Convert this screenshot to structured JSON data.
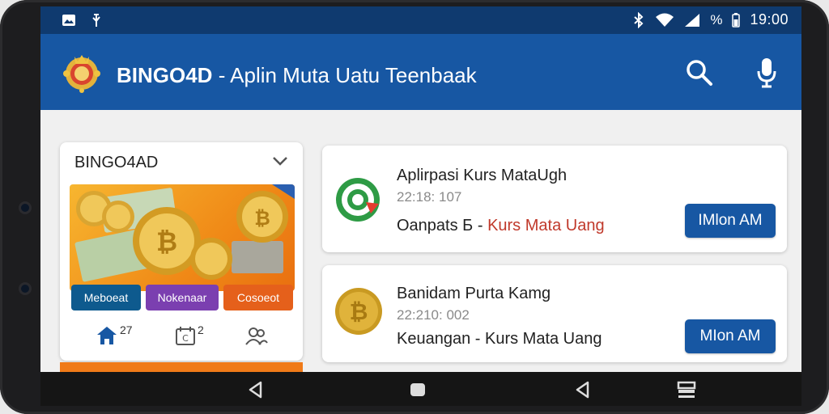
{
  "status_bar": {
    "time": "19:00",
    "battery_text": "%",
    "icons": [
      "gallery-icon",
      "usb-icon",
      "bluetooth-icon",
      "wifi-icon",
      "signal-icon",
      "battery-icon"
    ]
  },
  "app_bar": {
    "title_bold": "BINGO4D",
    "title_rest": " - Aplin Muta Uatu Teenbaak",
    "icons": [
      "logo-emblem",
      "search-icon",
      "mic-icon"
    ]
  },
  "left_card": {
    "title": "BINGO4AD",
    "buttons": [
      "Meboeat",
      "Nokenaar",
      "Cosoeot"
    ],
    "counters": [
      {
        "icon": "home-icon",
        "count": "27"
      },
      {
        "icon": "calendar-icon",
        "count": "2"
      },
      {
        "icon": "users-icon",
        "count": ""
      }
    ]
  },
  "cards": [
    {
      "title": "Aplirpasi Kurs MataUgh",
      "time": "22:18: 107",
      "desc_prefix": "Oanpats  Б - ",
      "desc_accent": "Kurs Mata Uang",
      "button": "IMlon AM",
      "icon": "target-arrow-icon"
    },
    {
      "title": "Banidam Purta Kamg",
      "time": "22:210: 002",
      "desc_prefix": "Keuangan - Kurs Mata Uang",
      "desc_accent": "",
      "button": "MIon AM",
      "icon": "bitcoin-coin-icon"
    }
  ],
  "colors": {
    "status_bar": "#0f3a6f",
    "app_bar": "#1757a3",
    "accent_red": "#c0392b",
    "pill_blue": "#0e5a8e",
    "pill_purple": "#7b3fb0",
    "pill_orange": "#e5601b"
  },
  "nav_bar": {
    "icons": [
      "back-icon",
      "home-nav-icon",
      "back-icon",
      "recents-icon"
    ]
  }
}
